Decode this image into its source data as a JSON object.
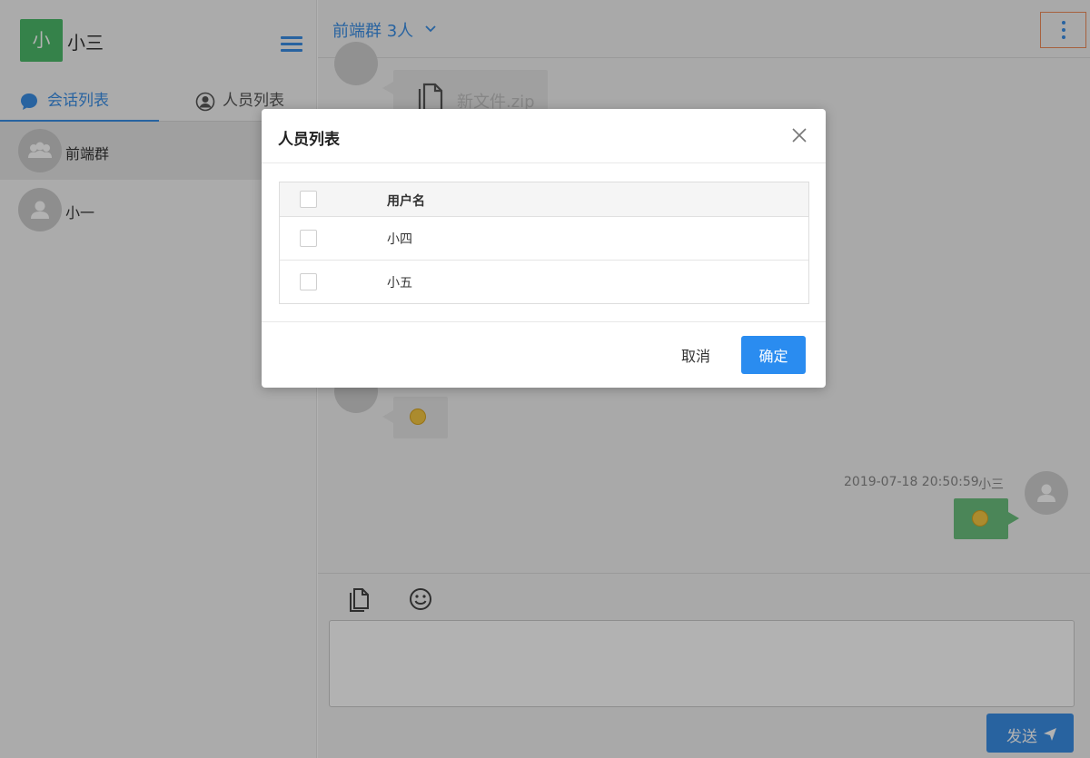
{
  "user": {
    "avatar_text": "小",
    "name": "小三"
  },
  "sidebar": {
    "tabs": [
      {
        "label": "会话列表",
        "active": true,
        "icon": "chat-bubble-icon"
      },
      {
        "label": "人员列表",
        "active": false,
        "icon": "person-icon"
      }
    ],
    "conversations": [
      {
        "name": "前端群",
        "type": "group",
        "active": true
      },
      {
        "name": "小一",
        "type": "single",
        "active": false
      }
    ]
  },
  "chat": {
    "title": "前端群 3人",
    "messages": [
      {
        "from": "other",
        "kind": "file",
        "file_name": "新文件.zip"
      },
      {
        "from": "other",
        "kind": "emoji"
      },
      {
        "from": "self",
        "kind": "emoji",
        "timestamp": "2019-07-18 20:50:59",
        "sender": "小三"
      }
    ],
    "composer": {
      "value": "",
      "send_label": "发送"
    }
  },
  "modal": {
    "title": "人员列表",
    "column_header": "用户名",
    "rows": [
      {
        "name": "小四",
        "checked": false
      },
      {
        "name": "小五",
        "checked": false
      }
    ],
    "cancel_label": "取消",
    "confirm_label": "确定"
  },
  "colors": {
    "accent": "#3a8ee6",
    "user_avatar": "#4cba6a",
    "self_bubble": "#6cc07e",
    "highlight_border": "#f08c5a"
  }
}
